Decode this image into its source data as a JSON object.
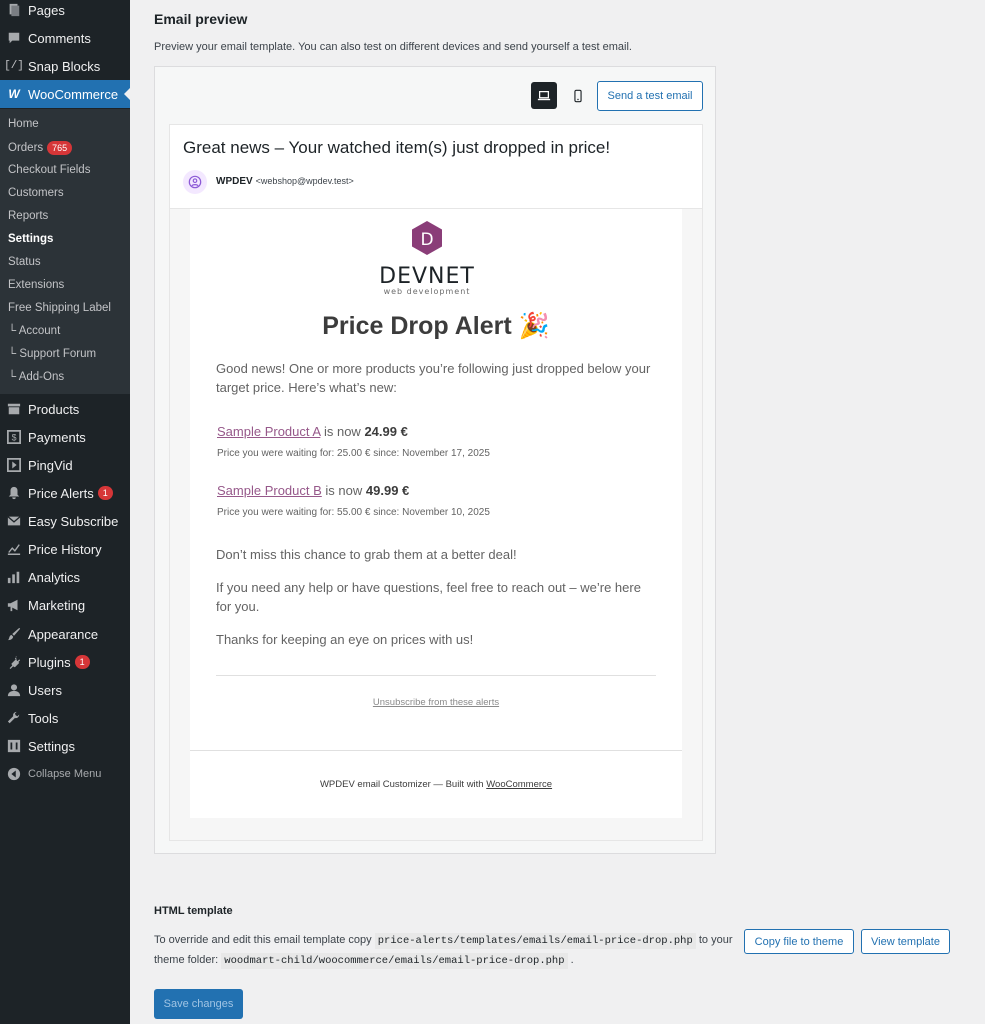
{
  "sidebar": {
    "items_top": [
      {
        "label": "Pages",
        "icon": "pages-icon"
      },
      {
        "label": "Comments",
        "icon": "comments-icon"
      },
      {
        "label": "Snap Blocks",
        "icon": "code-brackets-icon"
      },
      {
        "label": "WooCommerce",
        "icon": "woocommerce-icon"
      }
    ],
    "woo_submenu": [
      {
        "label": "Home"
      },
      {
        "label": "Orders",
        "badge": "765"
      },
      {
        "label": "Checkout Fields"
      },
      {
        "label": "Customers"
      },
      {
        "label": "Reports"
      },
      {
        "label": "Settings"
      },
      {
        "label": "Status"
      },
      {
        "label": "Extensions"
      },
      {
        "label": "Free Shipping Label"
      },
      {
        "label": "└ Account"
      },
      {
        "label": "└ Support Forum"
      },
      {
        "label": "└ Add-Ons"
      }
    ],
    "items_bottom": [
      {
        "label": "Products",
        "icon": "archive-icon"
      },
      {
        "label": "Payments",
        "icon": "dollar-icon"
      },
      {
        "label": "PingVid",
        "icon": "video-icon"
      },
      {
        "label": "Price Alerts",
        "icon": "bell-icon",
        "badge": "1"
      },
      {
        "label": "Easy Subscribe",
        "icon": "envelope-icon"
      },
      {
        "label": "Price History",
        "icon": "line-chart-icon"
      },
      {
        "label": "Analytics",
        "icon": "bar-chart-icon"
      },
      {
        "label": "Marketing",
        "icon": "megaphone-icon"
      },
      {
        "label": "Appearance",
        "icon": "paintbrush-icon"
      },
      {
        "label": "Plugins",
        "icon": "plug-icon",
        "badge": "1"
      },
      {
        "label": "Users",
        "icon": "user-icon"
      },
      {
        "label": "Tools",
        "icon": "wrench-icon"
      },
      {
        "label": "Settings",
        "icon": "settings-icon"
      },
      {
        "label": "Collapse Menu",
        "icon": "collapse-icon"
      }
    ]
  },
  "preview": {
    "title": "Email preview",
    "description": "Preview your email template. You can also test on different devices and send yourself a test email.",
    "send_test_label": "Send a test email",
    "subject": "Great news – Your watched item(s) just dropped in price!",
    "sender_name": "WPDEV",
    "sender_email": "<webshop@wpdev.test>"
  },
  "email": {
    "logo_letter": "D",
    "logo_name": "DEVNET",
    "logo_tagline": "web development",
    "heading": "Price Drop Alert 🎉",
    "intro": "Good news! One or more products you’re following just dropped below your target price. Here’s what’s new:",
    "products": [
      {
        "name": "Sample Product A",
        "is_now": "is now",
        "price": "24.99 €",
        "detail": "Price you were waiting for: 25.00 € since: November 17, 2025"
      },
      {
        "name": "Sample Product B",
        "is_now": "is now",
        "price": "49.99 €",
        "detail": "Price you were waiting for: 55.00 € since: November 10, 2025"
      }
    ],
    "p1": "Don’t miss this chance to grab them at a better deal!",
    "p2": "If you need any help or have questions, feel free to reach out – we’re here for you.",
    "p3": "Thanks for keeping an eye on prices with us!",
    "unsubscribe": "Unsubscribe from these alerts",
    "footer_prefix": "WPDEV email Customizer — Built with",
    "footer_link": "WooCommerce"
  },
  "template": {
    "title": "HTML template",
    "desc_1": "To override and edit this email template copy",
    "source_path": "price-alerts/templates/emails/email-price-drop.php",
    "desc_2": "to your theme folder:",
    "target_path": "woodmart-child/woocommerce/emails/email-price-drop.php",
    "desc_end": ".",
    "copy_label": "Copy file to theme",
    "view_label": "View template",
    "save_label": "Save changes"
  },
  "colors": {
    "sidebar_bg": "#1d2327",
    "active": "#2271b1",
    "link": "#96588a",
    "badge": "#d63638"
  }
}
